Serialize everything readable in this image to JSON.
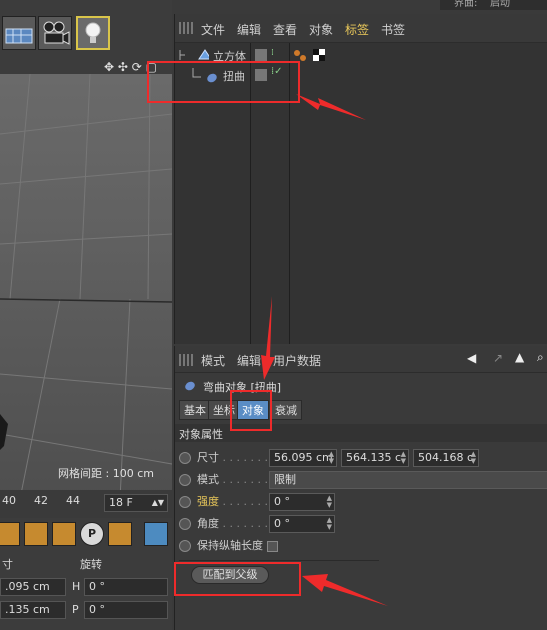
{
  "window": {
    "title_fragment": "界面:",
    "layout_value": "启动"
  },
  "viewport": {
    "grid_label": "网格间距 : 100 cm",
    "timeline_ticks": [
      "40",
      "42",
      "44"
    ],
    "current_frame": "18 F"
  },
  "coordinates": {
    "size_header": "寸",
    "rotation_header": "旋转",
    "rows": [
      {
        "value": ".095 cm",
        "axis": "H",
        "rotation": "0 °"
      },
      {
        "value": ".135 cm",
        "axis": "P",
        "rotation": "0 °"
      }
    ]
  },
  "object_manager": {
    "menu": [
      "文件",
      "编辑",
      "查看",
      "对象",
      "标签",
      "书签"
    ],
    "highlighted_menu": "标签",
    "objects": [
      {
        "name": "立方体",
        "color": "#e8c75a"
      },
      {
        "name": "扭曲",
        "color": "#e8c75a"
      }
    ]
  },
  "attribute_manager": {
    "menu": [
      "模式",
      "编辑",
      "用户数据"
    ],
    "object_title": "弯曲对象 [扭曲]",
    "tabs": [
      "基本",
      "坐标",
      "对象",
      "衰减"
    ],
    "active_tab": "对象",
    "section_title": "对象属性",
    "props": {
      "size_label": "尺寸",
      "size_values": [
        "56.095 cm",
        "564.135 c",
        "504.168 c"
      ],
      "mode_label": "模式",
      "mode_value": "限制",
      "strength_label": "强度",
      "strength_value": "0 °",
      "angle_label": "角度",
      "angle_value": "0 °",
      "keep_length_label": "保持纵轴长度"
    },
    "match_button": "匹配到父级"
  },
  "colors": {
    "annotation": "#ee2b2b",
    "accent": "#5a8dc5",
    "highlight": "#e8c75a"
  }
}
